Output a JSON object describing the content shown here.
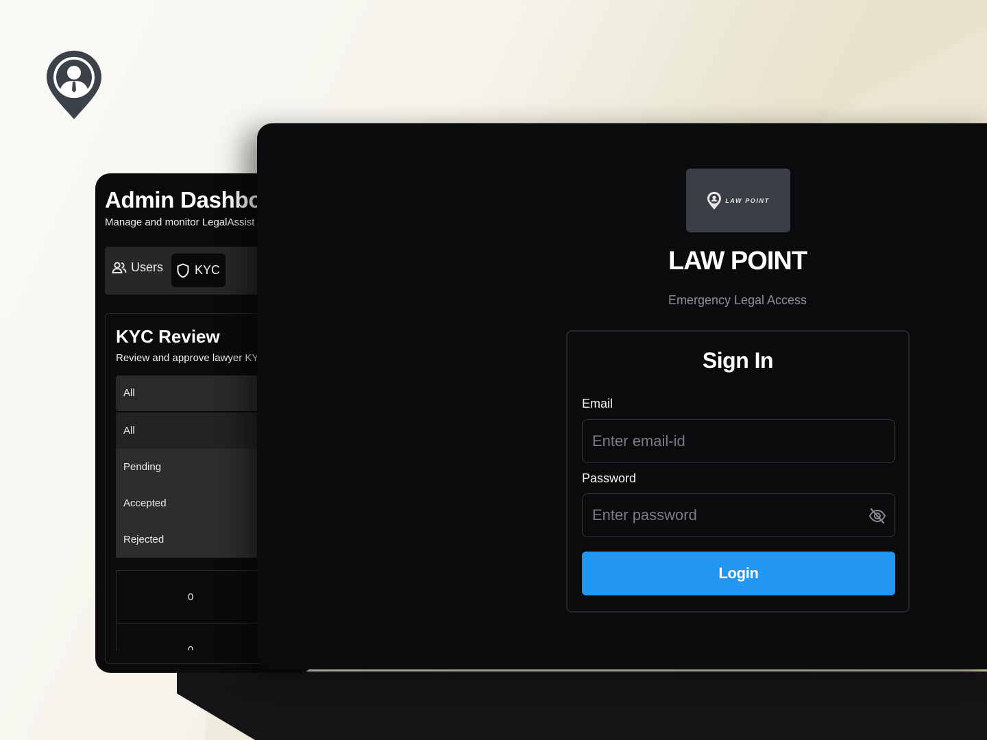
{
  "brand": {
    "pin_icon": "lawyer-pin-icon"
  },
  "admin": {
    "title": "Admin Dashboard",
    "subtitle": "Manage and monitor LegalAssist platform",
    "tabs": [
      {
        "label": "Users",
        "icon": "users-icon"
      },
      {
        "label": "KYC",
        "icon": "shield-icon"
      }
    ],
    "kyc": {
      "title": "KYC Review",
      "subtitle": "Review and approve lawyer KYC",
      "filter_value": "All",
      "filter_options": [
        "All",
        "Pending",
        "Accepted",
        "Rejected"
      ],
      "stats": [
        "0",
        "0"
      ]
    }
  },
  "login": {
    "logo_text": "LAW POINT",
    "app_name": "LAW POINT",
    "tagline": "Emergency Legal Access",
    "form": {
      "title": "Sign In",
      "email_label": "Email",
      "email_placeholder": "Enter email-id",
      "password_label": "Password",
      "password_placeholder": "Enter password",
      "submit_label": "Login"
    },
    "accent_color": "#2196f3"
  }
}
